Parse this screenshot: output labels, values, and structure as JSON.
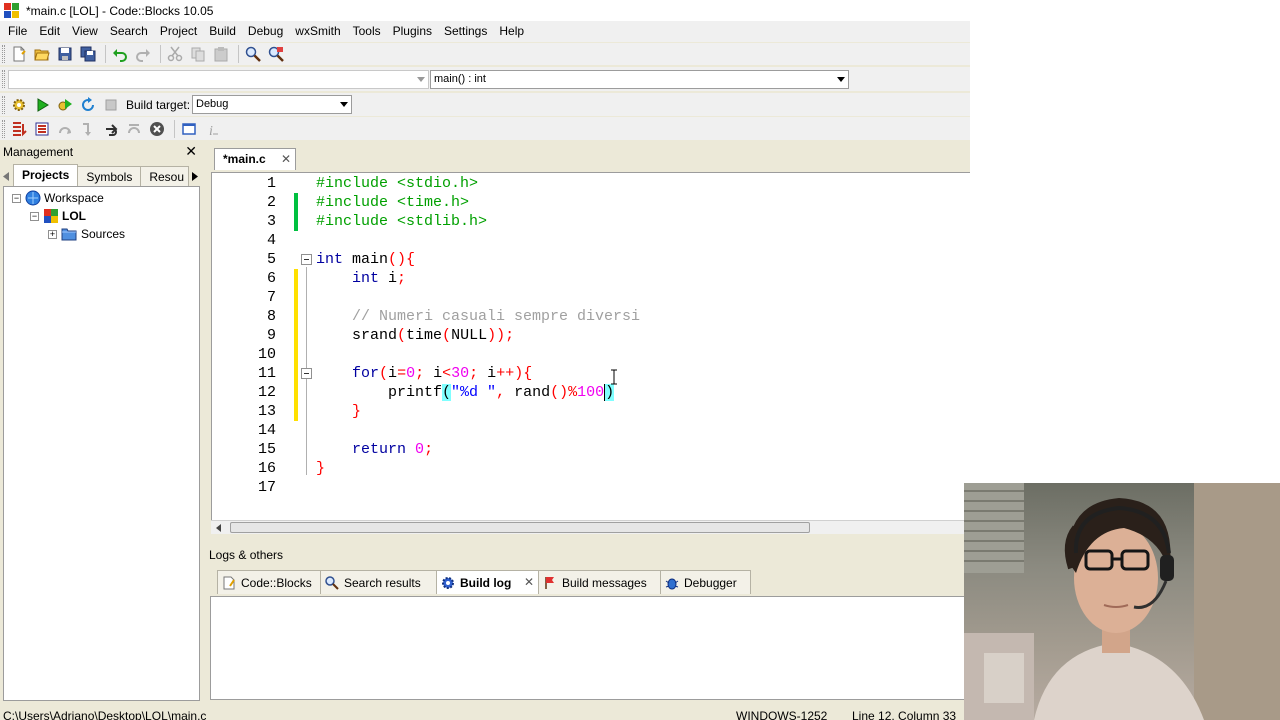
{
  "window": {
    "title": "*main.c [LOL] - Code::Blocks 10.05",
    "icon": "codeblocks-logo-icon"
  },
  "menu": [
    "File",
    "Edit",
    "View",
    "Search",
    "Project",
    "Build",
    "Debug",
    "wxSmith",
    "Tools",
    "Plugins",
    "Settings",
    "Help"
  ],
  "toolbar": {
    "scope_combo": "",
    "function_combo": "main() : int",
    "build_target_label": "Build target:",
    "build_target_value": "Debug"
  },
  "management": {
    "title": "Management",
    "tabs": [
      "Projects",
      "Symbols",
      "Resou"
    ],
    "tree": [
      {
        "label": "Workspace",
        "icon": "workspace-icon"
      },
      {
        "label": "LOL",
        "icon": "project-icon"
      },
      {
        "label": "Sources",
        "icon": "folder-icon"
      }
    ]
  },
  "editor": {
    "tab_label": "*main.c",
    "lines": [
      "1",
      "2",
      "3",
      "4",
      "5",
      "6",
      "7",
      "8",
      "9",
      "10",
      "11",
      "12",
      "13",
      "14",
      "15",
      "16",
      "17"
    ]
  },
  "logs": {
    "title": "Logs & others",
    "tabs": [
      {
        "label": "Code::Blocks",
        "icon": "document-icon"
      },
      {
        "label": "Search results",
        "icon": "search-icon"
      },
      {
        "label": "Build log",
        "icon": "gear-icon"
      },
      {
        "label": "Build messages",
        "icon": "flag-icon"
      },
      {
        "label": "Debugger",
        "icon": "bug-icon"
      }
    ]
  },
  "status": {
    "path": "C:\\Users\\Adriano\\Desktop\\LOL\\main.c",
    "encoding": "WINDOWS-1252",
    "position": "Line 12, Column 33"
  },
  "colors": {
    "keyword": "#0000a0",
    "preprocessor": "#00a000",
    "comment": "#a0a0a0",
    "operator": "#ff0000",
    "number": "#f000f0",
    "string": "#0000ff",
    "change_saved": "#00c040",
    "change_unsaved": "#ffe000"
  }
}
